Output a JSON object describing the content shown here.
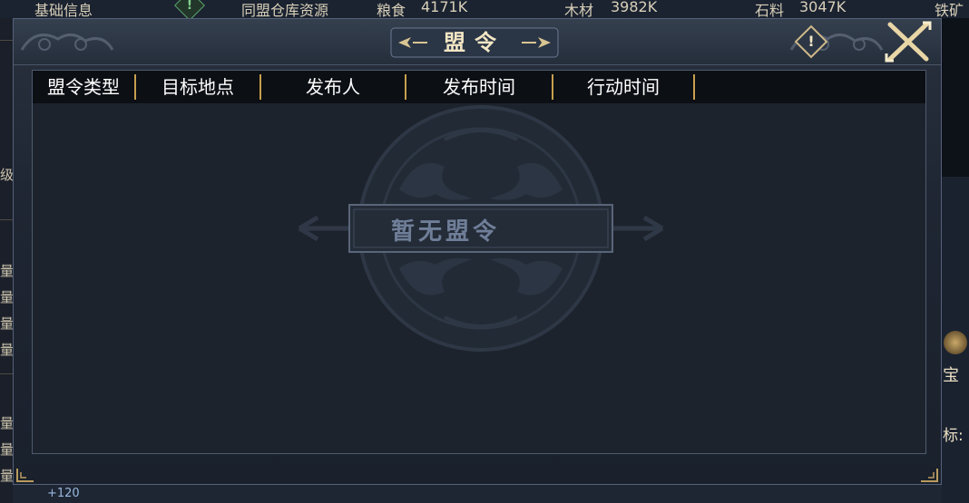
{
  "top_bar": {
    "basic_info": "基础信息",
    "alert_icon": "!",
    "warehouse_label": "同盟仓库资源",
    "food_label": "粮食",
    "food_value": "4171K",
    "wood_label": "木材",
    "wood_value": "3982K",
    "stone_label": "石料",
    "stone_value": "3047K",
    "iron_label": "铁矿"
  },
  "left_panel": {
    "glyphs": [
      "级",
      "量",
      "量",
      "量",
      "量",
      "量",
      "量",
      "量"
    ]
  },
  "right_panel": {
    "label_treasure": "宝",
    "label_coord": "标:"
  },
  "bottom_bar": {
    "value": "+120"
  },
  "modal": {
    "title": "盟令",
    "info_icon": "!",
    "columns": [
      "盟令类型",
      "目标地点",
      "发布人",
      "发布时间",
      "行动时间"
    ],
    "empty_text": "暂无盟令"
  },
  "colors": {
    "accent_gold": "#c79f4d",
    "title_text": "#f2e6c4",
    "header_bg": "#0c0f14",
    "panel_bg": "#1d232d"
  }
}
